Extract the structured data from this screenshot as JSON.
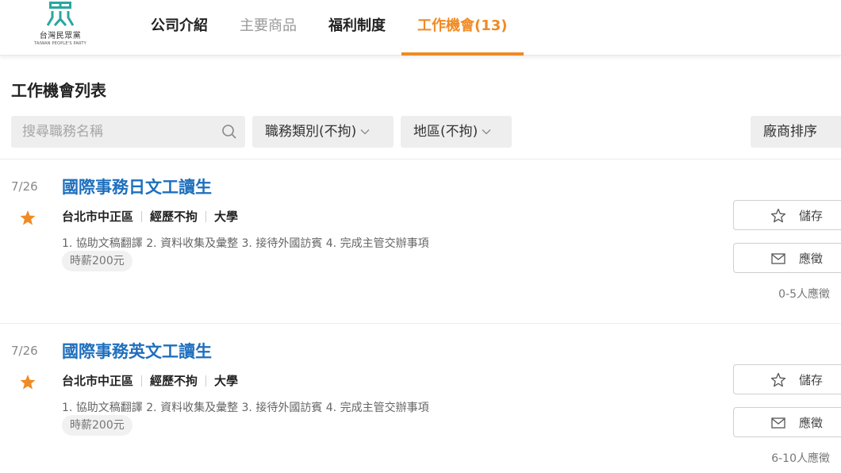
{
  "logo": {
    "mark": "眾",
    "name": "台灣民眾黨",
    "sub": "TAIWAN PEOPLE'S PARTY"
  },
  "nav": [
    {
      "label": "公司介紹",
      "state": "normal"
    },
    {
      "label": "主要商品",
      "state": "muted"
    },
    {
      "label": "福利制度",
      "state": "normal"
    },
    {
      "label": "工作機會(13)",
      "state": "active"
    }
  ],
  "list_title": "工作機會列表",
  "search": {
    "placeholder": "搜尋職務名稱",
    "value": ""
  },
  "filters": {
    "category": "職務類別(不拘)",
    "region": "地區(不拘)",
    "sort": "廠商排序"
  },
  "jobs": [
    {
      "date": "7/26",
      "title": "國際事務日文工讀生",
      "location": "台北市中正區",
      "experience": "經歷不拘",
      "education": "大學",
      "description": "1. 協助文稿翻譯 2. 資料收集及彙整 3. 接待外國訪賓 4. 完成主管交辦事項",
      "pay": "時薪200元",
      "save_label": "儲存",
      "apply_label": "應徵",
      "applicants": "0-5人應徵"
    },
    {
      "date": "7/26",
      "title": "國際事務英文工讀生",
      "location": "台北市中正區",
      "experience": "經歷不拘",
      "education": "大學",
      "description": "1. 協助文稿翻譯 2. 資料收集及彙整 3. 接待外國訪賓 4. 完成主管交辦事項",
      "pay": "時薪200元",
      "save_label": "儲存",
      "apply_label": "應徵",
      "applicants": "6-10人應徵"
    }
  ],
  "colors": {
    "accent": "#f08a24",
    "link": "#1e6fbe",
    "logo": "#2aa6a0"
  },
  "icons": [
    "search-icon",
    "chevron-down-icon",
    "featured-badge-icon",
    "star-icon",
    "mail-icon"
  ]
}
